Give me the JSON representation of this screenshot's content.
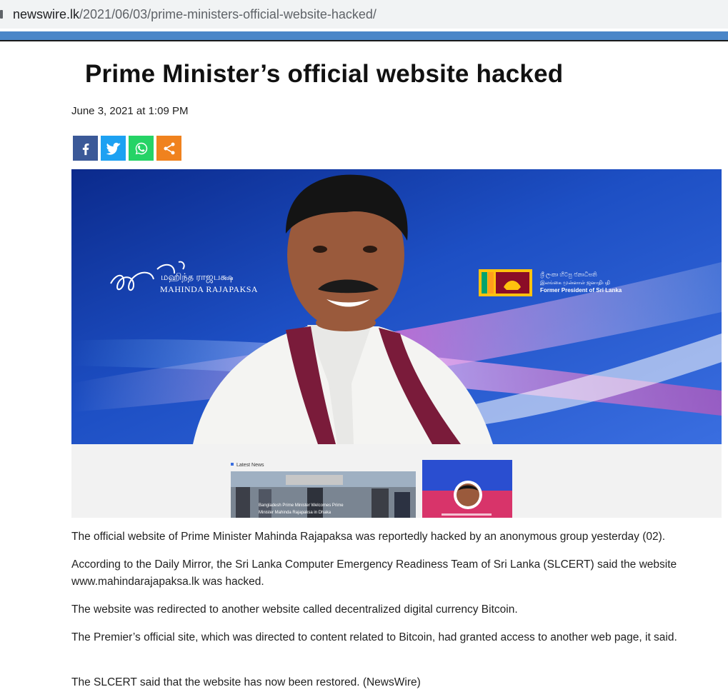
{
  "browser": {
    "url_domain": "newswire.lk",
    "url_path": "/2021/06/03/prime-ministers-official-website-hacked/"
  },
  "article": {
    "title": "Prime Minister’s official website hacked",
    "date": "June 3, 2021 at 1:09 PM",
    "share_buttons": [
      "facebook-icon",
      "twitter-icon",
      "whatsapp-icon",
      "share-icon"
    ],
    "paragraphs": [
      "The official website of Prime Minister Mahinda Rajapaksa was reportedly hacked by an anonymous group yesterday (02).",
      "According to the Daily Mirror, the Sri Lanka Computer Emergency Readiness Team of Sri Lanka (SLCERT) said the website www.mahindarajapaksa.lk was hacked.",
      "The website was redirected to another website called decentralized digital currency Bitcoin.",
      "The Premier’s official site, which was directed to content related to Bitcoin, had granted access to another web page, it said.",
      "The SLCERT said that the website has now been restored. (NewsWire)"
    ]
  },
  "hero_image": {
    "signature_name": "MAHINDA RAJAPAKSA",
    "former_title": "Former President of Sri Lanka",
    "latest_news_label": "Latest News",
    "news_caption": "Bangladesh Prime Minister Welcomes Prime Minister Mahinda Rajapaksa in Dhaka"
  },
  "colors": {
    "facebook": "#3b5998",
    "twitter": "#1da1f2",
    "whatsapp": "#25d366",
    "share": "#f0821e",
    "accent_bar": "#4a86c8"
  }
}
